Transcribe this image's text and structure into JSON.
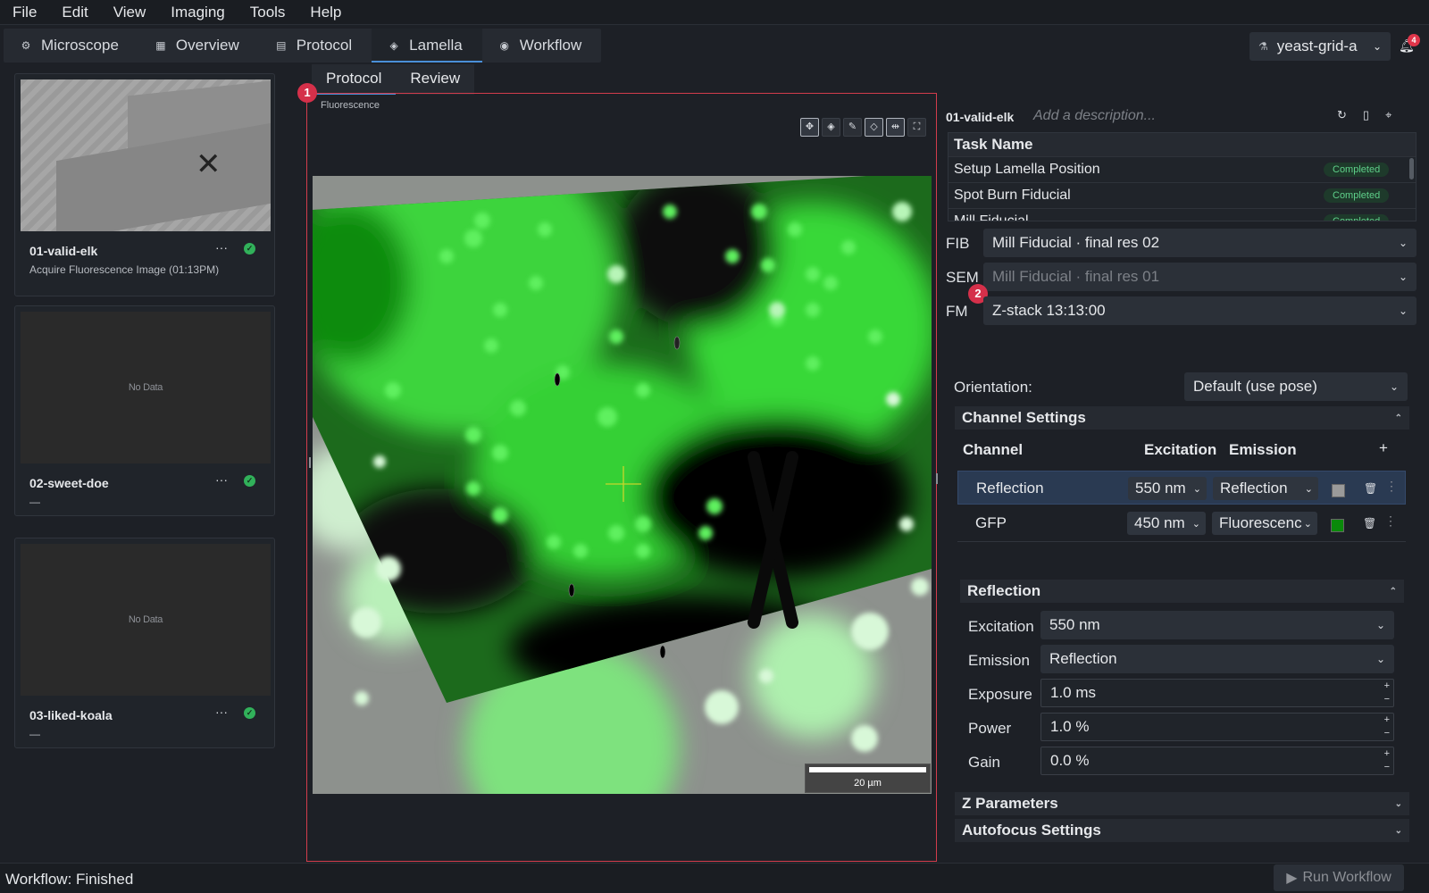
{
  "menu": [
    "File",
    "Edit",
    "View",
    "Imaging",
    "Tools",
    "Help"
  ],
  "top_tabs": [
    {
      "label": "Microscope",
      "icon": "microscope-icon",
      "glyph": "⚙"
    },
    {
      "label": "Overview",
      "icon": "map-icon",
      "glyph": "▦"
    },
    {
      "label": "Protocol",
      "icon": "document-icon",
      "glyph": "▤"
    },
    {
      "label": "Lamella",
      "icon": "layers-icon",
      "glyph": "◈"
    },
    {
      "label": "Workflow",
      "icon": "play-circle-icon",
      "glyph": "◉"
    }
  ],
  "active_top_tab": "Lamella",
  "project": {
    "name": "yeast-grid-a",
    "icon": "flask-icon"
  },
  "notifications": {
    "count": "4"
  },
  "lamellae": [
    {
      "name": "01-valid-elk",
      "subtitle": "Acquire Fluorescence Image (01:13PM)",
      "thumbnail": "em-image",
      "status": "done"
    },
    {
      "name": "02-sweet-doe",
      "subtitle": "—",
      "thumbnail_text": "No Data",
      "status": "done"
    },
    {
      "name": "03-liked-koala",
      "subtitle": "—",
      "thumbnail_text": "No Data",
      "status": "done"
    }
  ],
  "sub_tabs": [
    "Protocol",
    "Review"
  ],
  "active_sub_tab": "Protocol",
  "annotations": {
    "badge1": "1",
    "badge2": "2"
  },
  "viewer": {
    "label": "Fluorescence",
    "tools": [
      "move-icon",
      "layers-icon",
      "pencil-icon",
      "diamond-icon",
      "measure-icon",
      "fit-icon"
    ],
    "scale_bar": "20 µm",
    "colors": {
      "fluorescence": "#00d000",
      "highlight_frame": "#d23c4c"
    }
  },
  "detail": {
    "name": "01-valid-elk",
    "description_placeholder": "Add a description...",
    "icons": [
      "refresh-icon",
      "file-icon",
      "target-icon"
    ],
    "task_header": "Task Name",
    "tasks": [
      {
        "name": "Setup Lamella Position",
        "status": "Completed"
      },
      {
        "name": "Spot Burn Fiducial",
        "status": "Completed"
      },
      {
        "name": "Mill Fiducial",
        "status": "Completed"
      }
    ],
    "fib_label": "FIB",
    "fib_value": "Mill Fiducial · final res 02",
    "sem_label": "SEM",
    "sem_value": "Mill Fiducial · final res 01",
    "fm_label": "FM",
    "fm_value": "Z-stack 13:13:00",
    "orientation_label": "Orientation:",
    "orientation_value": "Default (use pose)",
    "channel_settings_title": "Channel Settings",
    "channel_headers": {
      "channel": "Channel",
      "excitation": "Excitation",
      "emission": "Emission",
      "add": "+"
    },
    "channels": [
      {
        "name": "Reflection",
        "excitation": "550 nm",
        "emission": "Reflection",
        "color": "#9a9a9a",
        "selected": true
      },
      {
        "name": "GFP",
        "excitation": "450 nm",
        "emission": "Fluorescence",
        "color": "#0a8a0a",
        "selected": false
      }
    ],
    "reflection_title": "Reflection",
    "excitation_label": "Excitation",
    "excitation_value": "550 nm",
    "emission_label": "Emission",
    "emission_value": "Reflection",
    "exposure_label": "Exposure",
    "exposure_value": "1.0 ms",
    "power_label": "Power",
    "power_value": "1.0 %",
    "gain_label": "Gain",
    "gain_value": "0.0 %",
    "z_title": "Z Parameters",
    "autofocus_title": "Autofocus Settings"
  },
  "status_text": "Workflow: Finished",
  "run_button": "Run Workflow"
}
